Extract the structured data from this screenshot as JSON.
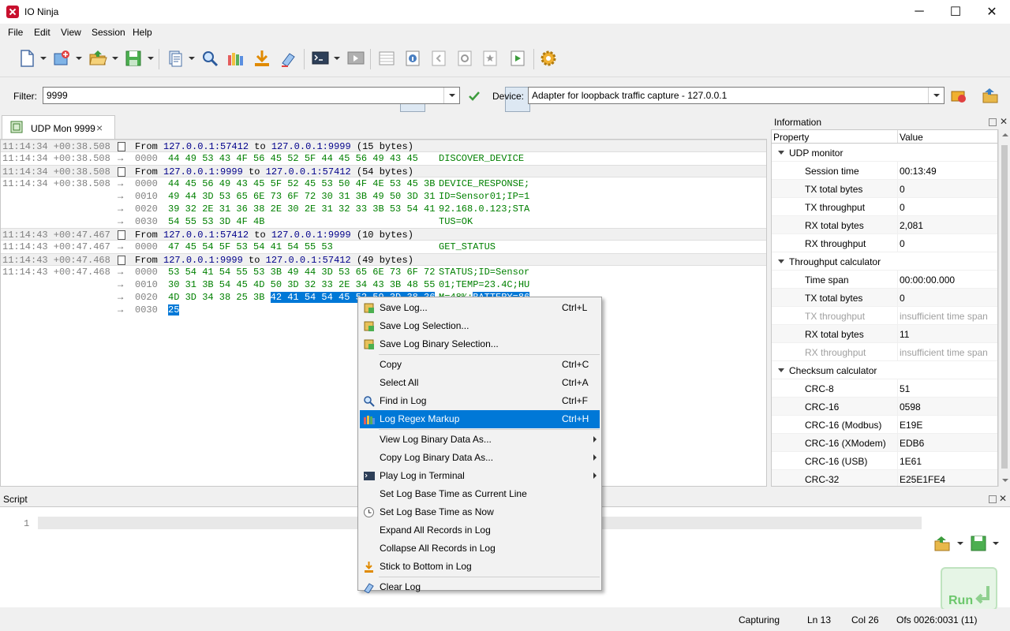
{
  "window": {
    "title": "IO Ninja",
    "minimize": "─",
    "maximize": "☐",
    "close": "✕"
  },
  "menu": [
    "File",
    "Edit",
    "View",
    "Session",
    "Help"
  ],
  "toolbar_icons": [
    "new-session-icon",
    "new-plugin-icon",
    "open-icon",
    "save-icon",
    "copy-doc-icon",
    "find-icon",
    "regex-markup-icon",
    "stick-to-bottom-icon",
    "clear-log-icon",
    "terminal-icon",
    "play-terminal-icon",
    "grid-icon",
    "info-icon",
    "back-icon",
    "session-icon",
    "bookmark-icon",
    "script-icon",
    "settings-icon"
  ],
  "filterbar": {
    "filter_label": "Filter:",
    "filter_value": "9999",
    "device_label": "Device:",
    "device_value": "Adapter for loopback traffic capture - 127.0.0.1"
  },
  "tab": {
    "label": "UDP Mon 9999",
    "close": "×"
  },
  "log": {
    "records": [
      {
        "type": "hdr",
        "ts": "11:14:34 +00:38.508",
        "prefix": "From ",
        "src": "127.0.0.1:57412",
        "mid": " to ",
        "dst": "127.0.0.1:9999",
        "suffix": " (15 bytes)"
      },
      {
        "type": "data",
        "ts": "11:14:34 +00:38.508",
        "offset": "0000",
        "hex": "44 49 53 43 4F 56 45 52 5F 44 45 56 49 43 45",
        "ascii": "DISCOVER_DEVICE"
      },
      {
        "type": "hdr",
        "ts": "11:14:34 +00:38.508",
        "prefix": "From ",
        "src": "127.0.0.1:9999",
        "mid": " to ",
        "dst": "127.0.0.1:57412",
        "suffix": " (54 bytes)"
      },
      {
        "type": "data",
        "ts": "11:14:34 +00:38.508",
        "offset": "0000",
        "hex": "44 45 56 49 43 45 5F 52 45 53 50 4F 4E 53 45 3B",
        "ascii": "DEVICE_RESPONSE;"
      },
      {
        "type": "data",
        "ts": "",
        "offset": "0010",
        "hex": "49 44 3D 53 65 6E 73 6F 72 30 31 3B 49 50 3D 31",
        "ascii": "ID=Sensor01;IP=1"
      },
      {
        "type": "data",
        "ts": "",
        "offset": "0020",
        "hex": "39 32 2E 31 36 38 2E 30 2E 31 32 33 3B 53 54 41",
        "ascii": "92.168.0.123;STA"
      },
      {
        "type": "data",
        "ts": "",
        "offset": "0030",
        "hex": "54 55 53 3D 4F 4B",
        "ascii": "TUS=OK"
      },
      {
        "type": "hdr",
        "ts": "11:14:43 +00:47.467",
        "prefix": "From ",
        "src": "127.0.0.1:57412",
        "mid": " to ",
        "dst": "127.0.0.1:9999",
        "suffix": " (10 bytes)"
      },
      {
        "type": "data",
        "ts": "11:14:43 +00:47.467",
        "offset": "0000",
        "hex": "47 45 54 5F 53 54 41 54 55 53",
        "ascii": "GET_STATUS"
      },
      {
        "type": "hdr",
        "ts": "11:14:43 +00:47.468",
        "prefix": "From ",
        "src": "127.0.0.1:9999",
        "mid": " to ",
        "dst": "127.0.0.1:57412",
        "suffix": " (49 bytes)"
      },
      {
        "type": "data",
        "ts": "11:14:43 +00:47.468",
        "offset": "0000",
        "hex": "53 54 41 54 55 53 3B 49 44 3D 53 65 6E 73 6F 72",
        "ascii": "STATUS;ID=Sensor"
      },
      {
        "type": "data",
        "ts": "",
        "offset": "0010",
        "hex": "30 31 3B 54 45 4D 50 3D 32 33 2E 34 43 3B 48 55",
        "ascii": "01;TEMP=23.4C;HU"
      },
      {
        "type": "data2",
        "ts": "",
        "offset": "0020",
        "hex_a": "4D 3D 34 38 25 3B ",
        "hex_b": "42 41 54 54 45 52 59 3D 38 36",
        "ascii_a": "M=48%;",
        "ascii_b": "BATTERY=86"
      },
      {
        "type": "data3",
        "ts": "",
        "offset": "0030",
        "hex_sel": "25"
      }
    ]
  },
  "info": {
    "title": "Information",
    "col_property": "Property",
    "col_value": "Value",
    "rows": [
      {
        "kind": "group",
        "label": "UDP monitor"
      },
      {
        "kind": "item",
        "prop": "Session time",
        "value": "00:13:49"
      },
      {
        "kind": "item",
        "prop": "TX total bytes",
        "value": "0"
      },
      {
        "kind": "item",
        "prop": "TX throughput",
        "value": "0"
      },
      {
        "kind": "item",
        "prop": "RX total bytes",
        "value": "2,081"
      },
      {
        "kind": "item",
        "prop": "RX throughput",
        "value": "0"
      },
      {
        "kind": "group",
        "label": "Throughput calculator"
      },
      {
        "kind": "item",
        "prop": "Time span",
        "value": "00:00:00.000"
      },
      {
        "kind": "item",
        "prop": "TX total bytes",
        "value": "0"
      },
      {
        "kind": "dim",
        "prop": "TX throughput",
        "value": "insufficient time span"
      },
      {
        "kind": "item",
        "prop": "RX total bytes",
        "value": "11"
      },
      {
        "kind": "dim",
        "prop": "RX throughput",
        "value": "insufficient time span"
      },
      {
        "kind": "group",
        "label": "Checksum calculator"
      },
      {
        "kind": "item",
        "prop": "CRC-8",
        "value": "51"
      },
      {
        "kind": "item",
        "prop": "CRC-16",
        "value": "0598"
      },
      {
        "kind": "item",
        "prop": "CRC-16 (Modbus)",
        "value": "E19E"
      },
      {
        "kind": "item",
        "prop": "CRC-16 (XModem)",
        "value": "EDB6"
      },
      {
        "kind": "item",
        "prop": "CRC-16 (USB)",
        "value": "1E61"
      },
      {
        "kind": "item",
        "prop": "CRC-32",
        "value": "E25E1FE4"
      }
    ]
  },
  "script": {
    "title": "Script",
    "line_no": "1",
    "run_label": "Run"
  },
  "status": {
    "state": "Capturing",
    "line": "Ln 13",
    "col": "Col 26",
    "offset": "Ofs 0026:0031 (11)"
  },
  "context_menu": {
    "items": [
      {
        "label": "Save Log...",
        "shortcut": "Ctrl+L",
        "icon": "save-log-icon"
      },
      {
        "label": "Save Log Selection...",
        "shortcut": "",
        "icon": "save-selection-icon"
      },
      {
        "label": "Save Log Binary Selection...",
        "shortcut": "",
        "icon": "save-binary-icon"
      },
      {
        "sep": true
      },
      {
        "label": "Copy",
        "shortcut": "Ctrl+C"
      },
      {
        "label": "Select All",
        "shortcut": "Ctrl+A"
      },
      {
        "label": "Find in Log",
        "shortcut": "Ctrl+F",
        "icon": "find-icon"
      },
      {
        "label": "Log Regex Markup",
        "shortcut": "Ctrl+H",
        "icon": "regex-markup-icon",
        "highlight": true
      },
      {
        "sep": true
      },
      {
        "label": "View Log Binary Data As...",
        "sub": true
      },
      {
        "label": "Copy Log Binary Data As...",
        "sub": true
      },
      {
        "label": "Play Log in Terminal",
        "sub": true,
        "icon": "terminal-icon"
      },
      {
        "label": "Set Log Base Time as Current Line"
      },
      {
        "label": "Set Log Base Time as Now",
        "icon": "clock-icon"
      },
      {
        "label": "Expand All Records in Log"
      },
      {
        "label": "Collapse All Records in Log"
      },
      {
        "label": "Stick to Bottom in Log",
        "icon": "stick-to-bottom-icon"
      },
      {
        "sep": true
      },
      {
        "label": "Clear Log",
        "icon": "clear-log-icon"
      }
    ]
  }
}
